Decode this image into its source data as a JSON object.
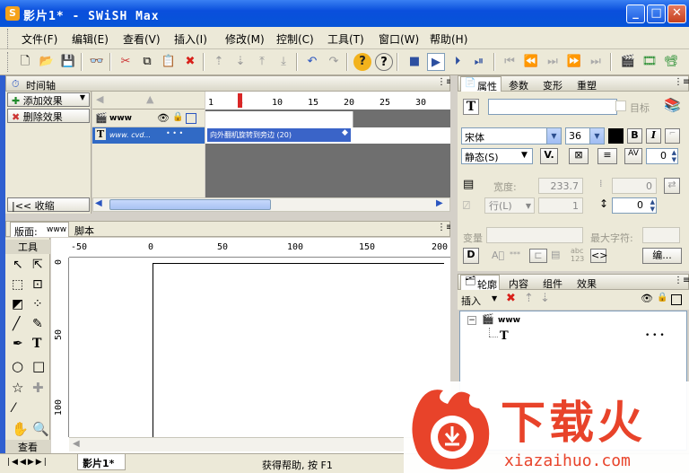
{
  "window": {
    "title": "影片1* - SWiSH Max",
    "min": "_",
    "max": "□",
    "close": "✕"
  },
  "menu": [
    "文件(F)",
    "编辑(E)",
    "查看(V)",
    "插入(I)",
    "修改(M)",
    "控制(C)",
    "工具(T)",
    "窗口(W)",
    "帮助(H)"
  ],
  "timeline": {
    "tab": "时间轴",
    "add_effect": "添加效果",
    "remove_effect": "删除效果",
    "collapse": "收缩",
    "collapse_icon": "|<<",
    "scene_name": "www",
    "text_name": "www. cvd...",
    "dots": "• • •",
    "effect_label": "向外翻机旋转到旁边 (20)",
    "frame_numbers": [
      "1",
      "5",
      "10",
      "15",
      "20",
      "25",
      "30"
    ]
  },
  "stage": {
    "tab_layout": "版面:",
    "tab_layout_value": "www",
    "tab_script": "脚本",
    "tools_title": "工具",
    "view_title": "查看",
    "ruler_h": [
      "-50",
      "0",
      "50",
      "100",
      "150",
      "200"
    ],
    "ruler_v": [
      "0",
      "50",
      "100"
    ],
    "doc_tab": "影片1*"
  },
  "properties": {
    "tabs": [
      "属性",
      "参数",
      "变形",
      "重塑"
    ],
    "target_label": "目标",
    "font": "宋体",
    "font_size": "36",
    "bold": "B",
    "italic": "I",
    "mode": "静态(S)",
    "kerning": "0",
    "width_label": "宽度:",
    "width_value": "233.7",
    "x_value": "0",
    "row_label": "行(L)",
    "row_value": "1",
    "line_spacing": "0",
    "var_label": "变量",
    "max_chars_label": "最大字符:",
    "abc_label": "abc 123",
    "edit_button": "编..."
  },
  "outline": {
    "tabs": [
      "轮廓",
      "内容",
      "组件",
      "效果"
    ],
    "insert_label": "插入",
    "tree": [
      {
        "label": "www",
        "icon": "scene-icon"
      },
      {
        "label": "T",
        "icon": "text-icon"
      }
    ],
    "dots": "• • •"
  },
  "status": {
    "help_text": "获得帮助, 按 F1"
  },
  "watermark": {
    "brand": "下载火",
    "url": "xiazaihuo.com"
  },
  "colors": {
    "titlebar": "#0a4fdc",
    "effect_bar": "#3a64c8",
    "watermark": "#e8432a",
    "playhead": "#d92626"
  }
}
